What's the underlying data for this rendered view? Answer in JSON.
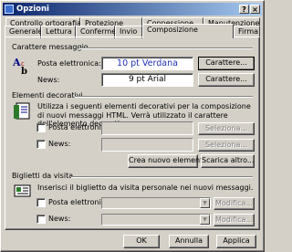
{
  "window": {
    "title": "Opzioni",
    "help_label": "?",
    "close_label": "×"
  },
  "tabs": {
    "row_back": [
      "Controllo ortografia",
      "Protezione",
      "Connessione",
      "Manutenzione"
    ],
    "row_front": [
      "Generale",
      "Lettura",
      "Conferme",
      "Invio",
      "Composizione",
      "Firma"
    ],
    "active": "Composizione"
  },
  "caratteri": {
    "title": "Carattere messaggio",
    "posta_label": "Posta elettronica:",
    "posta_value": "10 pt Verdana",
    "news_label": "News:",
    "news_value": "9 pt Arial",
    "button": "Carattere..."
  },
  "elementi": {
    "title": "Elementi decorativi",
    "description": "Utilizza i seguenti elementi decorativi per la composizione di nuovi messaggi HTML. Verrà utilizzato il carattere dell'elemento decorativo.",
    "posta_label": "Posta elettronica:",
    "news_label": "News:",
    "select_button": "Seleziona...",
    "create_button": "Crea nuovo elemento",
    "download_button": "Scarica altro..."
  },
  "biglietti": {
    "title": "Biglietti da visita",
    "description": "Inserisci il biglietto da visita personale nei nuovi messaggi.",
    "posta_label": "Posta elettronica:",
    "news_label": "News:",
    "edit_button": "Modifica..."
  },
  "footer": {
    "ok": "OK",
    "cancel": "Annulla",
    "apply": "Applica"
  },
  "colors": {
    "title_start": "#0a246a",
    "title_end": "#a6caf0",
    "font_value_blue": "#2030b8",
    "face": "#d4d0c8"
  }
}
